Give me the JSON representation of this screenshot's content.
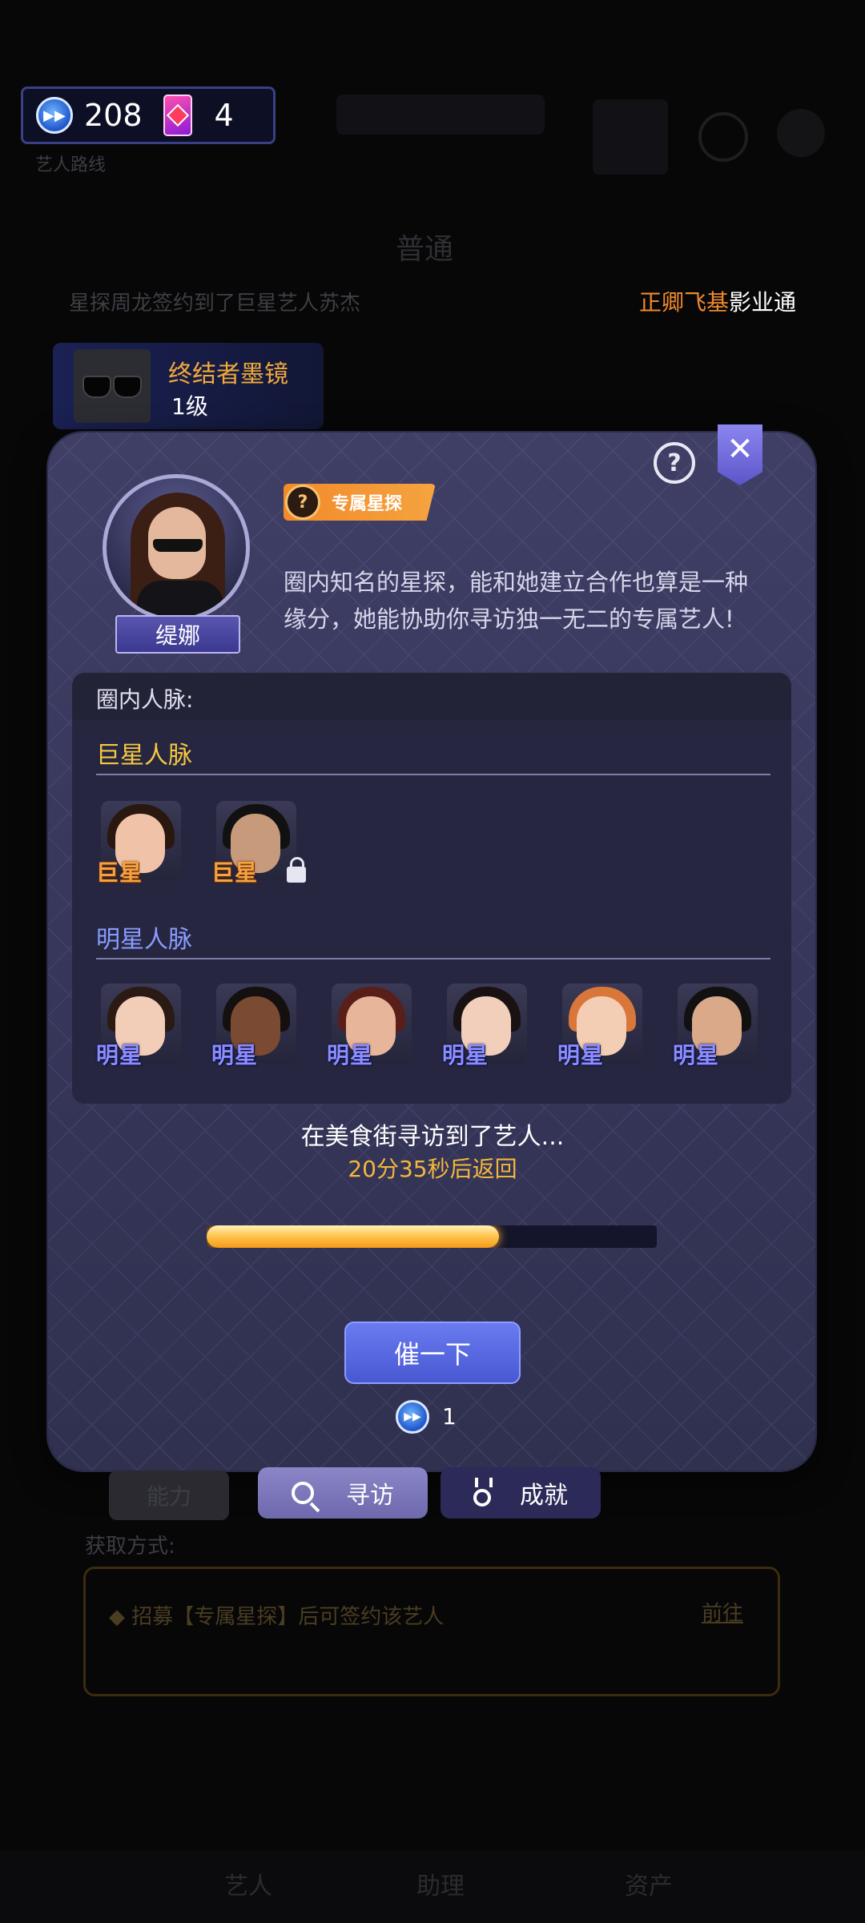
{
  "currency": {
    "stopwatch_count": "208",
    "card_count": "4"
  },
  "marquee": {
    "left_text": "星探周龙签约到了巨星艺人苏杰",
    "right_highlight": "正卿飞基",
    "right_suffix": "影业通"
  },
  "item": {
    "name": "终结者墨镜",
    "level": "1级"
  },
  "scout": {
    "name": "缇娜",
    "badge": "专属星探",
    "badge_icon_glyph": "?",
    "desc_line1": "圈内知名的星探，能和她建立合作也算是一种",
    "desc_line2": "缘分，她能协助你寻访独一无二的专属艺人!"
  },
  "network": {
    "title": "圈内人脉:",
    "super_title": "巨星人脉",
    "star_title": "明星人脉",
    "super_avatars": [
      {
        "label": "巨星",
        "skin": "#f0c3a8",
        "hair": "#2a1710",
        "locked": false
      },
      {
        "label": "巨星",
        "skin": "#c89a7c",
        "hair": "#111111",
        "locked": true
      }
    ],
    "star_avatars": [
      {
        "label": "明星",
        "skin": "#f2cdb8",
        "hair": "#2b1a14"
      },
      {
        "label": "明星",
        "skin": "#7a4a32",
        "hair": "#151010"
      },
      {
        "label": "明星",
        "skin": "#e7b59a",
        "hair": "#5a1e18"
      },
      {
        "label": "明星",
        "skin": "#f1cfba",
        "hair": "#1a1212"
      },
      {
        "label": "明星",
        "skin": "#f4cdb5",
        "hair": "#d9773a"
      },
      {
        "label": "明星",
        "skin": "#d9a98a",
        "hair": "#111111"
      }
    ]
  },
  "status": {
    "message": "在美食街寻访到了艺人...",
    "countdown": "20分35秒后返回",
    "progress": 0.65
  },
  "actions": {
    "urge_label": "催一下",
    "cost": "1"
  },
  "tabs": {
    "ability": "能力",
    "visit": "寻访",
    "achievement": "成就"
  },
  "acquire": {
    "label": "获取方式:",
    "text": "◆ 招募【专属星探】后可签约该艺人",
    "go": "前往"
  },
  "bottom_nav": {
    "artist": "艺人",
    "assistant": "助理",
    "asset": "资产"
  },
  "colors": {
    "accent_orange": "#f5a340",
    "star_blue": "#8a8dff",
    "button_blue": "#4858d2",
    "super_yellow": "#f5c842"
  }
}
